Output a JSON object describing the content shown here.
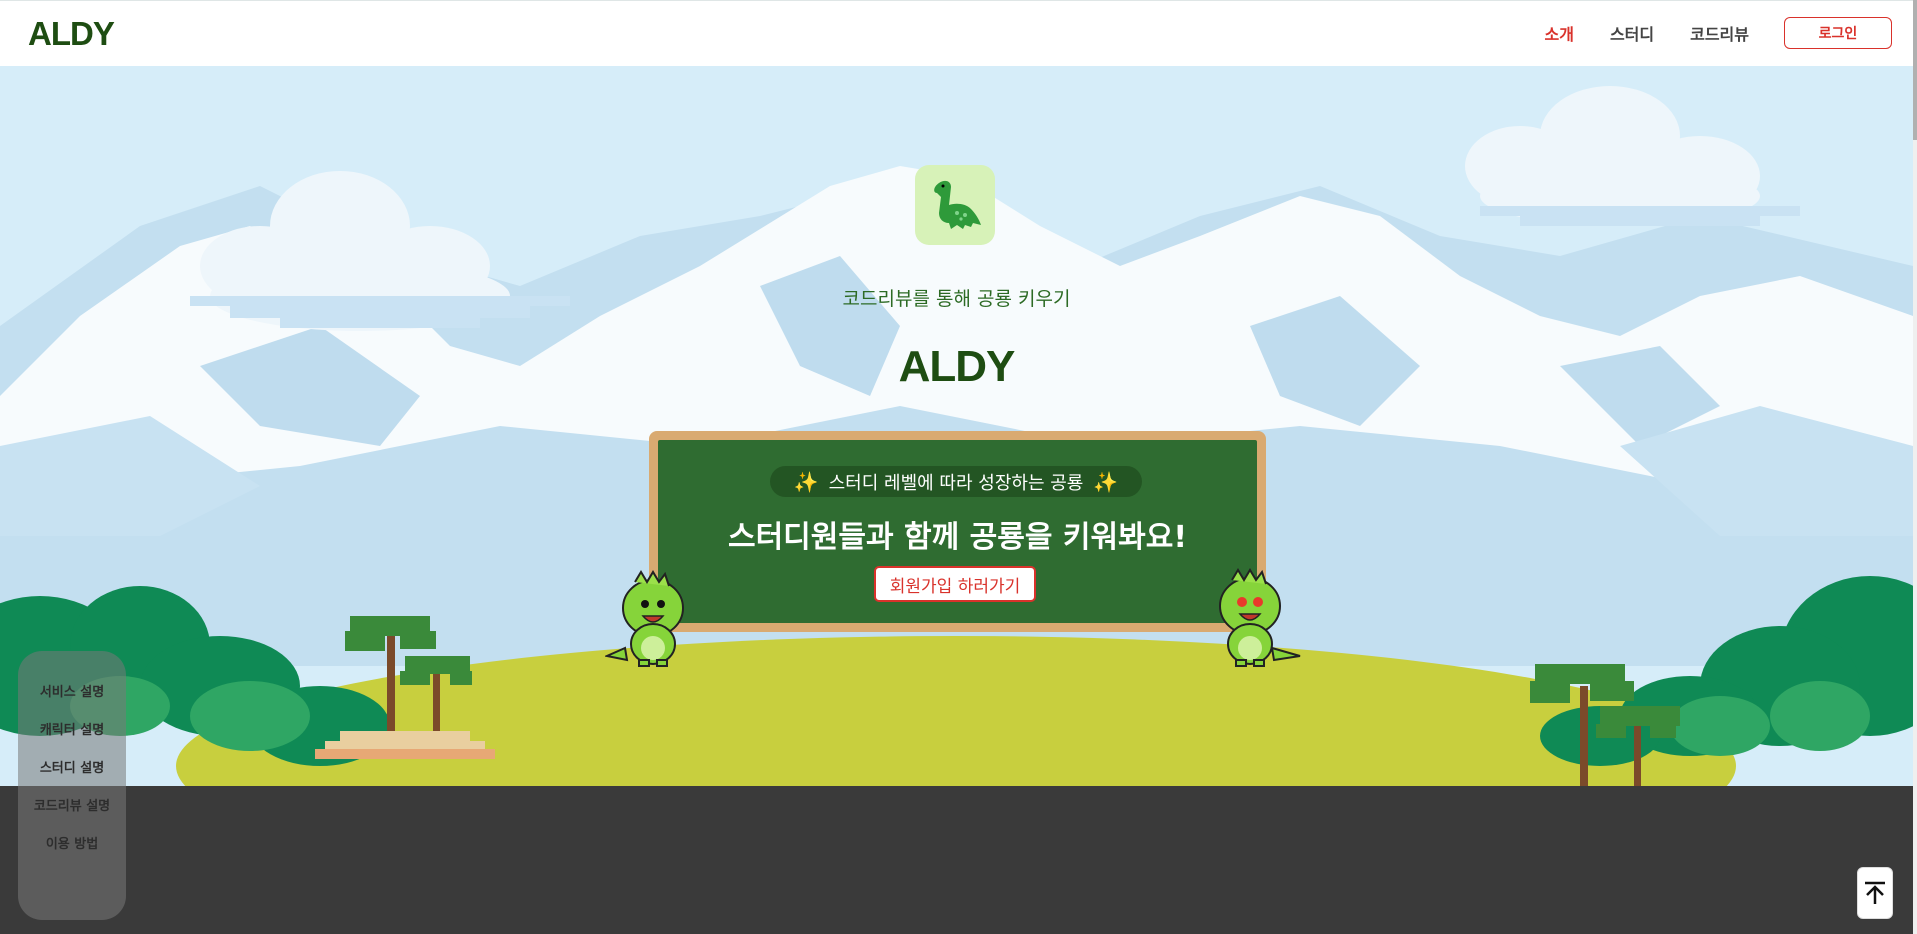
{
  "header": {
    "logo": "ALDY",
    "nav": [
      {
        "label": "소개",
        "active": true
      },
      {
        "label": "스터디",
        "active": false
      },
      {
        "label": "코드리뷰",
        "active": false
      }
    ],
    "login_label": "로그인"
  },
  "hero": {
    "subtitle": "코드리뷰를 통해 공룡 키우기",
    "title": "ALDY",
    "board": {
      "pill_text": "스터디 레벨에 따라 성장하는 공룡",
      "heading": "스터디원들과 함께 공룡을 키워봐요!",
      "signup_label": "회원가입 하러가기"
    }
  },
  "side_nav": {
    "items": [
      "서비스 설명",
      "캐릭터 설명",
      "스터디 설명",
      "코드리뷰 설명",
      "이용 방법"
    ]
  },
  "colors": {
    "brand_green": "#1e4d12",
    "accent_red": "#d9322b",
    "board_green": "#2f6c31",
    "sky": "#d4ecf8",
    "footer": "#3a3a3a"
  },
  "icons": {
    "logo_icon": "dinosaur-icon",
    "top_button_icon": "arrow-up-to-top-icon"
  }
}
